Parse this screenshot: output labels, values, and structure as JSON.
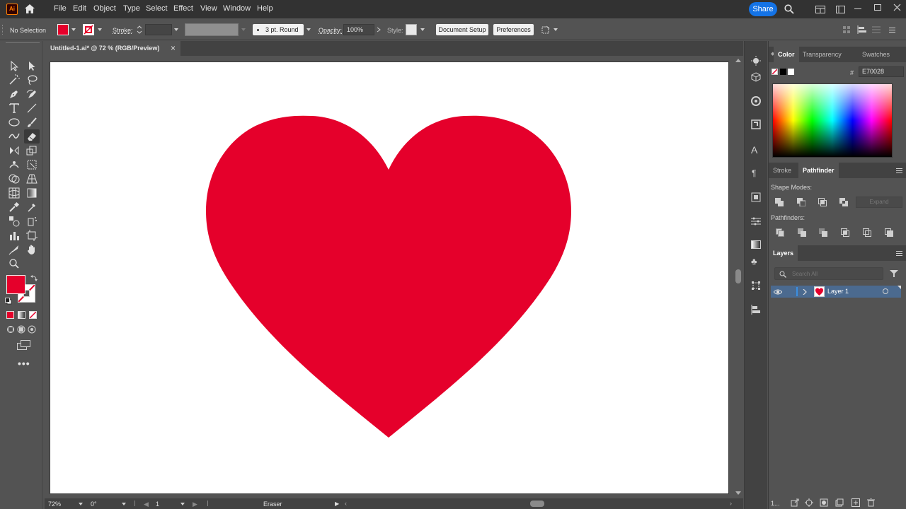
{
  "app": {
    "logo": "Ai"
  },
  "menu": [
    "File",
    "Edit",
    "Object",
    "Type",
    "Select",
    "Effect",
    "View",
    "Window",
    "Help"
  ],
  "header": {
    "share_label": "Share"
  },
  "control_bar": {
    "selection": "No Selection",
    "stroke_label": "Stroke:",
    "brush_label": "3 pt. Round",
    "opacity_label": "Opacity:",
    "opacity_value": "100%",
    "style_label": "Style:",
    "document_setup": "Document Setup",
    "preferences": "Preferences"
  },
  "document": {
    "tab_title": "Untitled-1.ai* @ 72 % (RGB/Preview)",
    "close": "×"
  },
  "canvas": {
    "heart_color": "#E5002B",
    "fill_color": "#E5002B"
  },
  "status_bar": {
    "zoom": "72%",
    "rotation": "0°",
    "artboard": "1",
    "tool": "Eraser"
  },
  "color_panel": {
    "tabs": [
      "Color",
      "Transparency",
      "Swatches"
    ],
    "active_tab": "Color",
    "hex": "E70028"
  },
  "pathfinder_panel": {
    "tabs": [
      "Stroke",
      "Pathfinder"
    ],
    "active_tab": "Pathfinder",
    "shape_modes": "Shape Modes:",
    "expand": "Expand",
    "pathfinders": "Pathfinders:"
  },
  "layers_panel": {
    "tab": "Layers",
    "search_placeholder": "Search All",
    "layers": [
      {
        "name": "Layer 1"
      }
    ],
    "footer_count": "1..."
  },
  "colors": {
    "accent": "#1473e6",
    "ui_dark": "#323232",
    "ui_mid": "#535353",
    "layer_highlight": "#4b6a8f"
  }
}
